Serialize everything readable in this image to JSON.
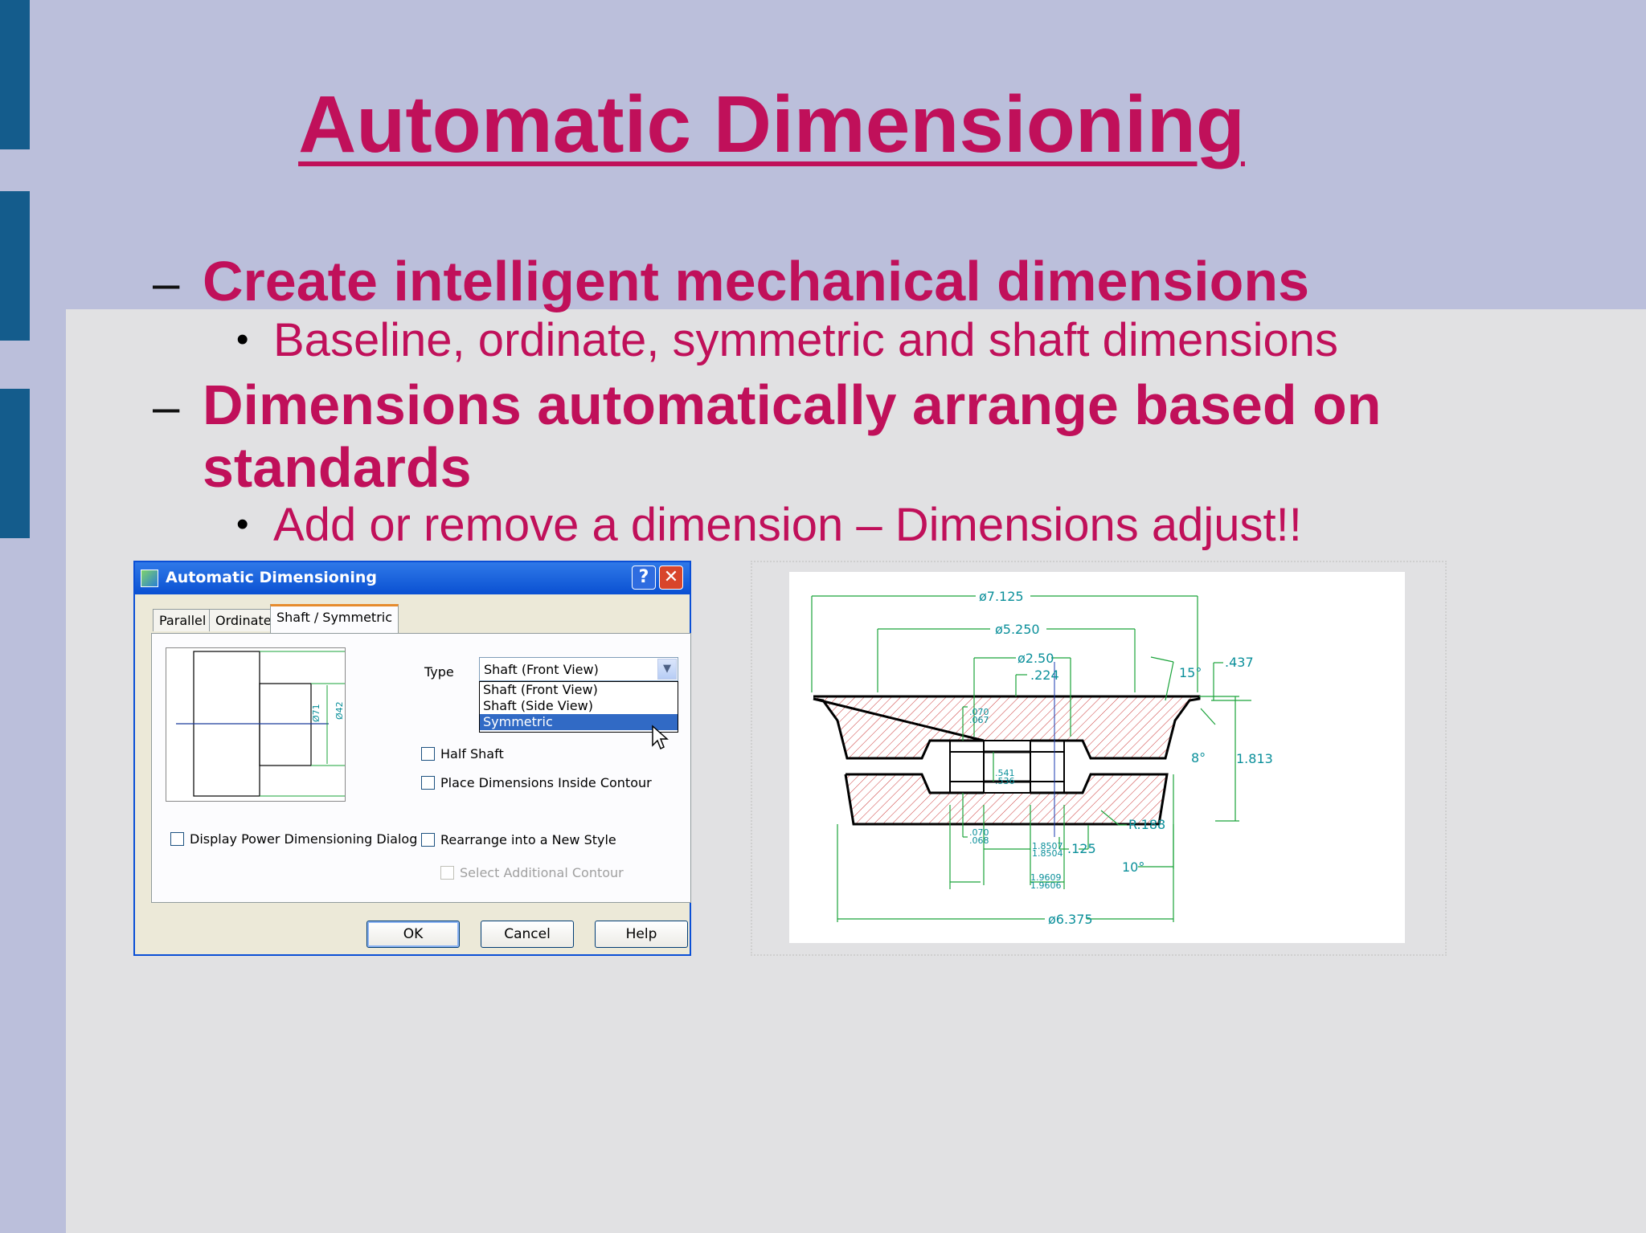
{
  "slide": {
    "title": "Automatic Dimensioning",
    "points": [
      {
        "text": "Create intelligent mechanical dimensions",
        "sub": "Baseline, ordinate, symmetric and shaft dimensions"
      },
      {
        "text_line1": "Dimensions automatically arrange based on",
        "text_line2": "standards",
        "sub": "Add or remove a dimension – Dimensions adjust!!"
      }
    ],
    "dash": "–",
    "bullet": "•"
  },
  "dialog": {
    "title": "Automatic Dimensioning",
    "help_btn": "?",
    "close_btn": "✕",
    "tabs": [
      "Parallel",
      "Ordinate",
      "Shaft / Symmetric"
    ],
    "active_tab": "Shaft / Symmetric",
    "type_label": "Type",
    "type_value": "Shaft (Front View)",
    "type_options": [
      "Shaft (Front View)",
      "Shaft (Side View)",
      "Symmetric"
    ],
    "highlighted_option": "Symmetric",
    "checkboxes": {
      "half_shaft": "Half Shaft",
      "place_inside": "Place Dimensions Inside Contour",
      "display_power": "Display Power Dimensioning Dialog",
      "rearrange": "Rearrange into a New Style",
      "select_additional": "Select Additional Contour"
    },
    "preview_labels": [
      "Ø71",
      "Ø42"
    ],
    "buttons": {
      "ok": "OK",
      "cancel": "Cancel",
      "help": "Help"
    }
  },
  "drawing": {
    "dims": {
      "d1": "ø7.125",
      "d2": "ø5.250",
      "d3": "ø2.50",
      "d4": ".224",
      "d5": ".437",
      "d6": "15°",
      "d7": "8°",
      "d8": "1.813",
      "d9": ".070",
      "d9b": ".067",
      "d10": ".541",
      "d10b": ".536",
      "d11": ".070",
      "d11b": ".068",
      "d12": "1.8507",
      "d12b": "1.8504",
      "d13": ".125",
      "d14": "R.188",
      "d15": "10°",
      "d16": "1.9609",
      "d16b": "1.9606",
      "d17": "ø6.375"
    }
  },
  "colors": {
    "accent": "#c0105a",
    "dim_line": "#1aa33a",
    "dim_text": "#0a8f9a",
    "hatch": "#cc3a3a",
    "xp_blue": "#0a50d2"
  }
}
